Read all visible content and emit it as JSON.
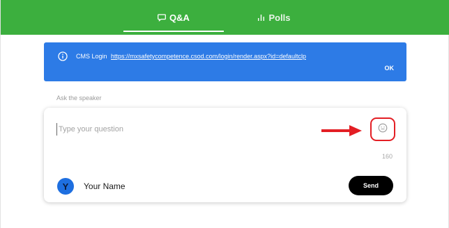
{
  "tabs": [
    {
      "label": "Q&A",
      "icon": "chat-bubble-icon",
      "active": true
    },
    {
      "label": "Polls",
      "icon": "bar-chart-icon",
      "active": false
    }
  ],
  "banner": {
    "prefix": "CMS Login",
    "link": "https://mxsafetycompetence.csod.com/login/render.aspx?id=defaultclp",
    "ok_label": "OK",
    "icon": "info-icon"
  },
  "ask_label": "Ask the speaker",
  "question": {
    "value": "",
    "placeholder": "Type your question",
    "char_count": "160",
    "emoji_icon": "emoji-smile-icon"
  },
  "user": {
    "avatar_initial": "Y",
    "name_placeholder": "Your Name"
  },
  "send_label": "Send",
  "colors": {
    "tabbar": "#3caf3e",
    "banner": "#2d7be6",
    "highlight": "#e31e24",
    "avatar": "#1e6fe0",
    "send": "#000000"
  }
}
